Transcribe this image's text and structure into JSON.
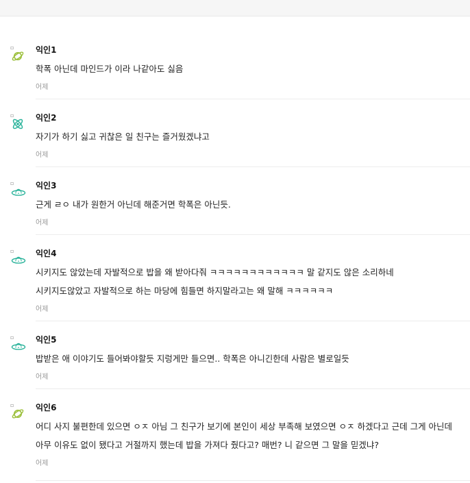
{
  "comments": [
    {
      "author": "익인1",
      "icon": "planet-icon",
      "color": "#9bbf3a",
      "lines": [
        "학폭 아닌데 마인드가 이라 나같아도 싫음"
      ],
      "time": "어제"
    },
    {
      "author": "익인2",
      "icon": "atom-icon",
      "color": "#2bb39b",
      "lines": [
        "자기가 하기 싫고 귀찮은 일 친구는 즐거웠겠냐고"
      ],
      "time": "어제"
    },
    {
      "author": "익인3",
      "icon": "ufo-icon",
      "color": "#2bb39b",
      "lines": [
        "근게 ㄹㅇ 내가 원한거 아닌데 해준거면 학폭은 아닌듯."
      ],
      "time": "어제"
    },
    {
      "author": "익인4",
      "icon": "ufo-icon",
      "color": "#2bb39b",
      "lines": [
        "시키지도 않았는데 자발적으로 밥을 왜 받아다줘 ㅋㅋㅋㅋㅋㅋㅋㅋㅋㅋㅋㅋ 말 같지도 않은 소리하네",
        "시키지도않았고 자발적으로 하는 마당에 힘들면 하지말라고는 왜 말해 ㅋㅋㅋㅋㅋㅋ"
      ],
      "time": "어제"
    },
    {
      "author": "익인5",
      "icon": "ufo-icon",
      "color": "#2bb39b",
      "lines": [
        "밥받은 애 이야기도 들어봐야할듯 지렁게만 들으면.. 학폭은 아니긴한데 사람은 별로일듯"
      ],
      "time": "어제"
    },
    {
      "author": "익인6",
      "icon": "planet-icon",
      "color": "#9bbf3a",
      "lines": [
        "어디 사지 불편한데 있으면 ㅇㅈ 아님 그 친구가 보기에 본인이 세상 부족해 보였으면 ㅇㅈ 하겠다고 근데 그게 아닌데",
        "아무 이유도 없이 됐다고 거절까지 했는데 밥을 가져다 줬다고? 매번? 니 같으면 그 말을 믿겠냐?"
      ],
      "time": "어제"
    }
  ]
}
